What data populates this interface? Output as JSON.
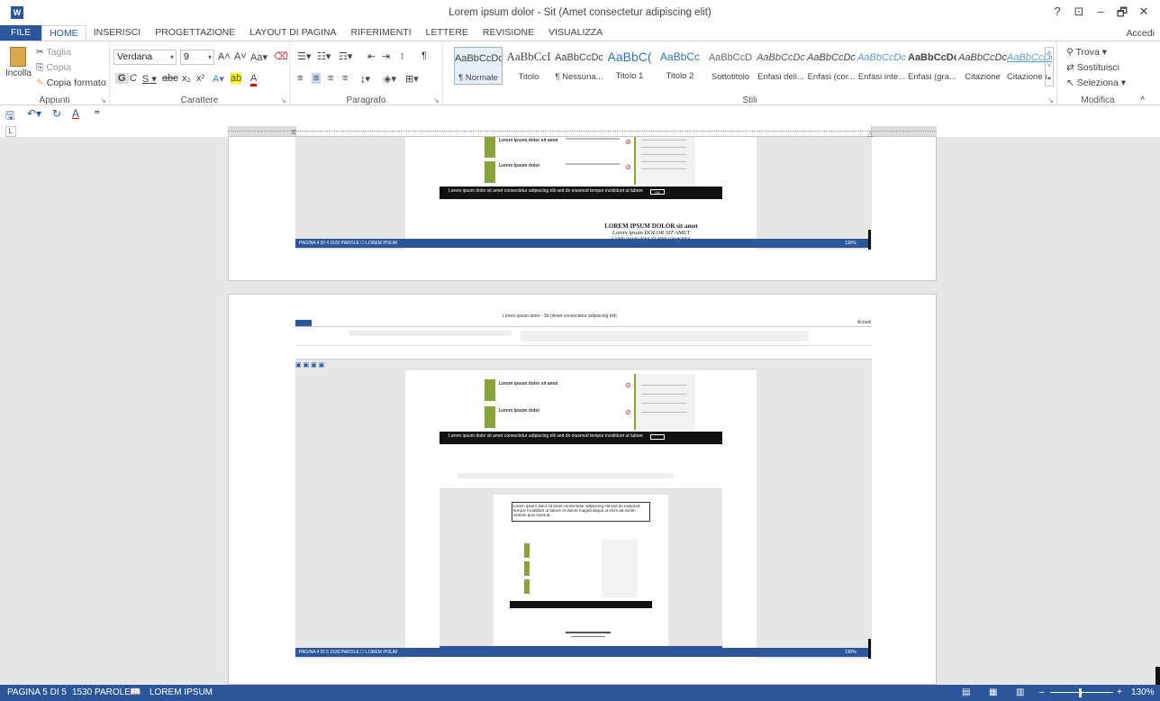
{
  "title_bar": {
    "title": "Lorem ipsum dolor - Sit (Amet consectetur adipiscing elit)",
    "controls": [
      "?",
      "⊡",
      "–",
      "🗗",
      "✕"
    ]
  },
  "tabs": [
    "FILE",
    "HOME",
    "INSERISCI",
    "PROGETTAZIONE",
    "LAYOUT DI PAGINA",
    "RIFERIMENTI",
    "LETTERE",
    "REVISIONE",
    "VISUALIZZA"
  ],
  "account_label": "Accedi",
  "ribbon": {
    "clipboard": {
      "group_label": "Appunti",
      "paste_label": "Incolla",
      "cut_label": "Taglia",
      "copy_label": "Copia",
      "format_painter_label": "Copia formato"
    },
    "font": {
      "group_label": "Carattere",
      "font_name": "Verdana",
      "font_size": "9"
    },
    "paragraph": {
      "group_label": "Paragrafo"
    },
    "styles": {
      "group_label": "Stili",
      "items": [
        {
          "preview": "AaBbCcDc",
          "name": "¶ Normale"
        },
        {
          "preview": "AaBbCcI",
          "name": "Titolo"
        },
        {
          "preview": "AaBbCcDc",
          "name": "¶ Nessuna..."
        },
        {
          "preview": "AaBbC(",
          "name": "Titolo 1"
        },
        {
          "preview": "AaBbCc",
          "name": "Titolo 2"
        },
        {
          "preview": "AaBbCcD",
          "name": "Sottotitolo"
        },
        {
          "preview": "AaBbCcDc",
          "name": "Enfasi deli..."
        },
        {
          "preview": "AaBbCcDc",
          "name": "Enfasi (cor..."
        },
        {
          "preview": "AaBbCcDc",
          "name": "Enfasi inte..."
        },
        {
          "preview": "AaBbCcDc",
          "name": "Enfasi (gra..."
        },
        {
          "preview": "AaBbCcDc",
          "name": "Citazione"
        },
        {
          "preview": "AaBbCcDc",
          "name": "Citazione i..."
        }
      ]
    },
    "editing": {
      "group_label": "Modifica",
      "find_label": "Trova",
      "replace_label": "Sostituisci",
      "select_label": "Seleziona"
    }
  },
  "document": {
    "signature_title": "LOREM IPSUM DOLOR sit amet",
    "signature_name": "Lorem ipsum DOLOR SIT AMET",
    "signature_note": "Lorem ipsum dolor sit amet consectetur",
    "embedded_title": "Lorem ipsum dolor - Sit (Amet consectetur adipiscing elit)",
    "embedded_status_p4": "PAGINA 4 DI 4   1530 PAROLE   ☐   LOREM IPSUM",
    "embedded_status_p5": "PAGINA 4 DI 5   1530 PAROLE   ☐   LOREM IPSUM",
    "embedded_zoom": "130%",
    "inner_text_box": "Lorem ipsum dolor sit amet consectetur adipiscing elit sed do eiusmod tempor incididunt ut labore et dolore magna aliqua ut enim ad minim veniam quis nostrud",
    "row1_title": "Lorem ipsum dolor sit amet",
    "row2_title": "Lorem ipsum dolor",
    "cookie_text": "Lorem ipsum dolor sit amet consectetur adipiscing elit sed do eiusmod tempor incididunt ut labore",
    "cookie_ok": "OK"
  },
  "status_bar": {
    "page": "PAGINA 5 DI 5",
    "words": "1530 PAROLE",
    "language": "LOREM IPSUM",
    "zoom": "130%"
  }
}
